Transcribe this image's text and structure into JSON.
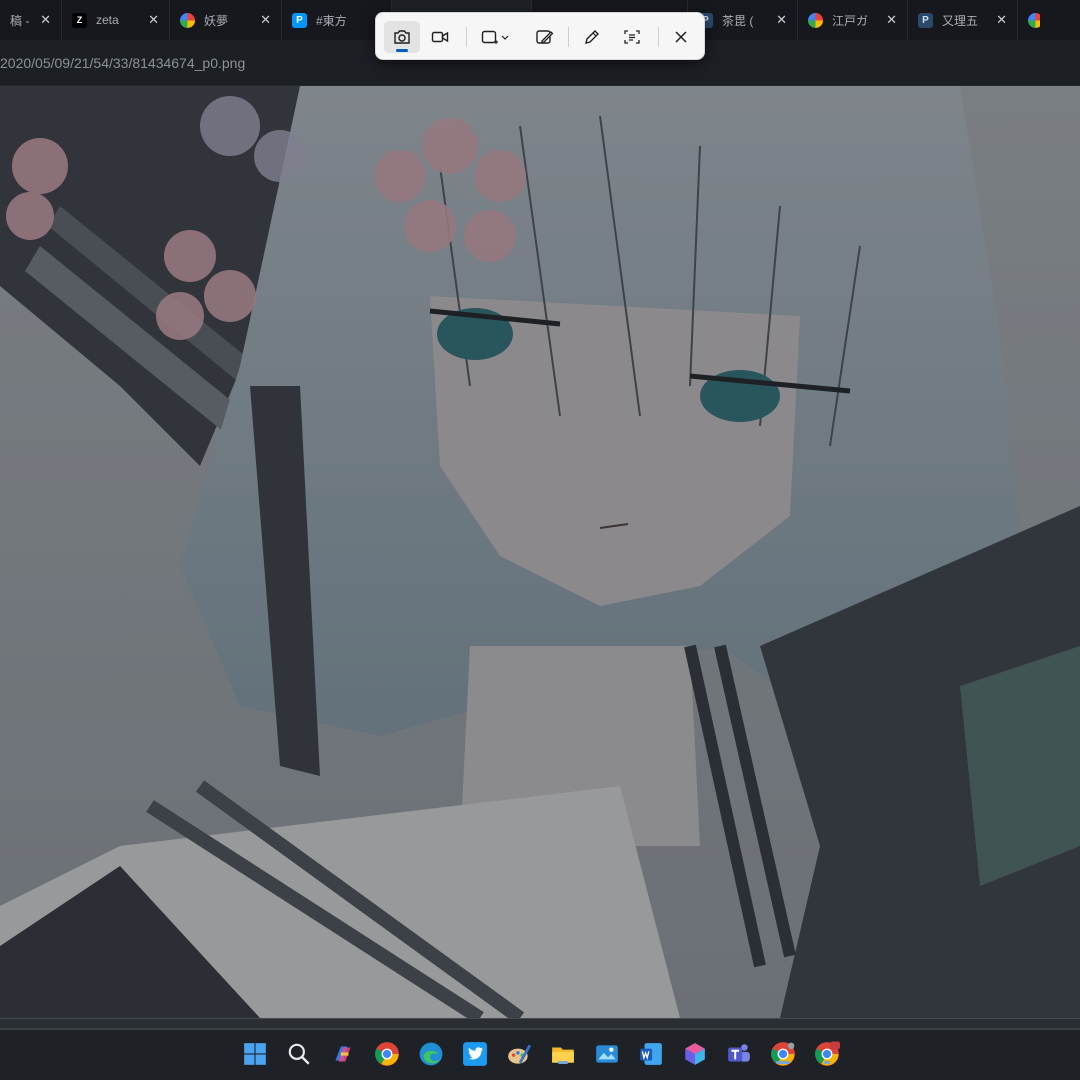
{
  "tabs": [
    {
      "title": "稿 - (",
      "favicon": "generic-icon"
    },
    {
      "title": "zeta",
      "favicon": "zeta-icon"
    },
    {
      "title": "妖夢",
      "favicon": "google-icon"
    },
    {
      "title": "#東方",
      "favicon": "pixiv-icon"
    },
    {
      "title": "",
      "favicon": "blank-icon"
    },
    {
      "title": "",
      "favicon": "blank-icon"
    },
    {
      "title": "茶毘 (",
      "favicon": "pixiv-icon"
    },
    {
      "title": "江戸ガ",
      "favicon": "google-icon"
    },
    {
      "title": "又理五",
      "favicon": "pixiv-icon"
    },
    {
      "title": "",
      "favicon": "google-icon"
    }
  ],
  "tab_close_glyph": "✕",
  "address": {
    "url_fragment": "2020/05/09/21/54/33/81434674_p0.png"
  },
  "snip_toolbar": {
    "buttons": [
      "camera-icon",
      "video-icon",
      "rectangle-mode-icon",
      "edit-image-icon",
      "pen-icon",
      "text-actions-icon",
      "close-icon"
    ],
    "active_mode": "camera-icon",
    "accent": "#005fb8"
  },
  "taskbar": {
    "icons": [
      "windows-start-icon",
      "search-icon",
      "copilot-icon",
      "chrome-icon",
      "edge-icon",
      "twitter-icon",
      "paint-icon",
      "file-explorer-icon",
      "photos-icon",
      "word-icon",
      "m365-icon",
      "teams-icon",
      "chrome-icon",
      "chrome-profile-icon"
    ]
  }
}
